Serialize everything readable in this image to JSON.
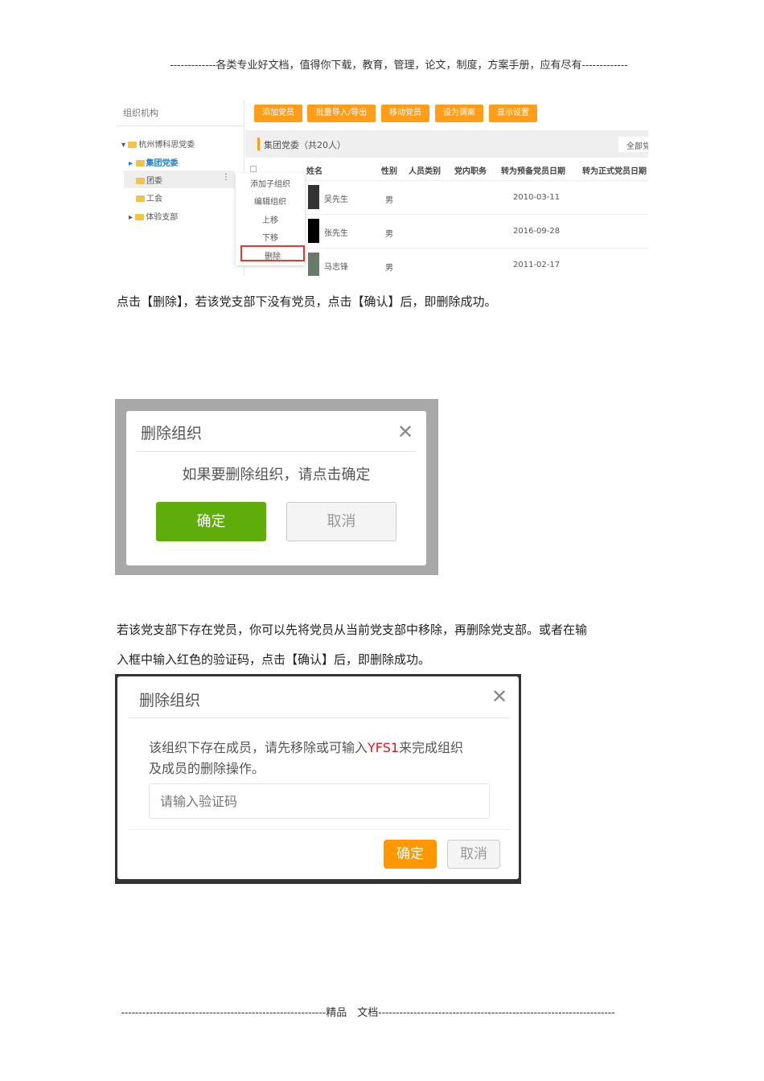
{
  "header": "-------------各类专业好文档，值得你下载，教育，管理，论文，制度，方案手册，应有尽有-------------",
  "screenshot1": {
    "panel_title": "组织机构",
    "tree": [
      "杭州博科思党委",
      "集团党委",
      "团委",
      "工会",
      "体验支部"
    ],
    "toolbar": [
      "添加党员",
      "批量导入/导出",
      "移动党员",
      "设为调离",
      "显示设置"
    ],
    "org_title": "集团党委（共20人）",
    "filter": "全部党",
    "columns": [
      "姓名",
      "性别",
      "人员类别",
      "党内职务",
      "转为预备党员日期",
      "转为正式党员日期"
    ],
    "rows": [
      {
        "name": "吴先生",
        "gender": "男",
        "date": "2010-03-11"
      },
      {
        "name": "张先生",
        "gender": "男",
        "date": "2016-09-28"
      },
      {
        "name": "马志锋",
        "gender": "男",
        "date": "2011-02-17"
      }
    ],
    "menu": [
      "添加子组织",
      "编辑组织",
      "上移",
      "下移",
      "删除"
    ],
    "highlight_color": "#e53935"
  },
  "para1": "点击【删除】，若该党支部下没有党员，点击【确认】后，即删除成功。",
  "dialog1": {
    "title": "删除组织",
    "message": "如果要删除组织，请点击确定",
    "confirm": "确定",
    "cancel": "取消",
    "confirm_color": "#5fad0a"
  },
  "para2a": "若该党支部下存在党员，你可以先将党员从当前党支部中移除，再删除党支部。或者在输",
  "para2b": "入框中输入红色的验证码，点击【确认】后，即删除成功。",
  "dialog2": {
    "title": "删除组织",
    "msg_pre": "该组织下存在成员，请先移除或可输入",
    "code": "YFS1",
    "msg_post": "来完成组织",
    "msg_line2": "及成员的删除操作。",
    "placeholder": "请输入验证码",
    "confirm": "确定",
    "cancel": "取消",
    "confirm_color": "#ff9800",
    "code_color": "#e8141c"
  },
  "footer": "----------------------------------------------------------精品　文档-------------------------------------------------------------------"
}
